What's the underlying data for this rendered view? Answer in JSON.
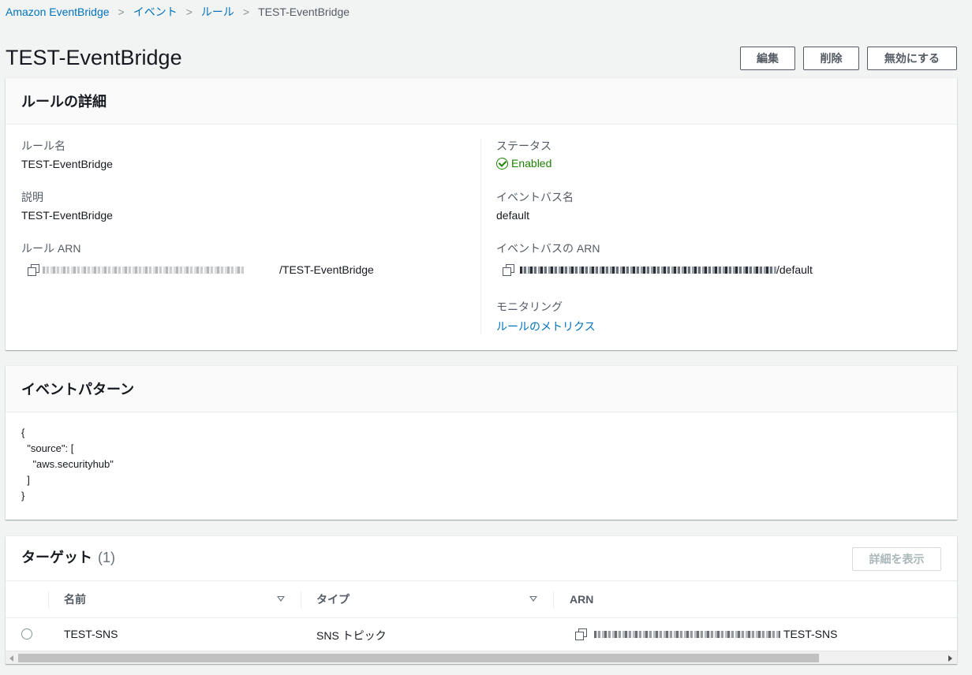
{
  "breadcrumb": {
    "items": [
      "Amazon EventBridge",
      "イベント",
      "ルール"
    ],
    "current": "TEST-EventBridge"
  },
  "header": {
    "title": "TEST-EventBridge",
    "buttons": {
      "edit": "編集",
      "delete": "削除",
      "disable": "無効にする"
    }
  },
  "rule_details": {
    "title": "ルールの詳細",
    "rule_name_label": "ルール名",
    "rule_name": "TEST-EventBridge",
    "description_label": "説明",
    "description": "TEST-EventBridge",
    "rule_arn_label": "ルール ARN",
    "rule_arn_suffix": "/TEST-EventBridge",
    "status_label": "ステータス",
    "status": "Enabled",
    "event_bus_name_label": "イベントバス名",
    "event_bus_name": "default",
    "event_bus_arn_label": "イベントバスの ARN",
    "event_bus_arn_suffix": "/default",
    "monitoring_label": "モニタリング",
    "monitoring_link": "ルールのメトリクス"
  },
  "event_pattern": {
    "title": "イベントパターン",
    "code": "{\n  \"source\": [\n    \"aws.securityhub\"\n  ]\n}"
  },
  "targets": {
    "title": "ターゲット",
    "count": "(1)",
    "view_details_button": "詳細を表示",
    "columns": [
      "名前",
      "タイプ",
      "ARN"
    ],
    "rows": [
      {
        "name": "TEST-SNS",
        "type": "SNS トピック",
        "arn_suffix": "TEST-SNS"
      }
    ]
  },
  "colors": {
    "link": "#0073bb",
    "success": "#1d8102",
    "background": "#f2f3f3"
  }
}
